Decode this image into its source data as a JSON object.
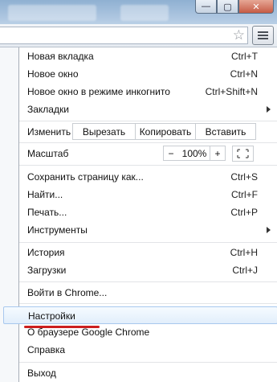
{
  "window": {
    "minimize": "—",
    "maximize": "▢",
    "close": "✕"
  },
  "toolbar": {
    "bookmark_icon": "star-icon",
    "menu_icon": "wrench-menu-icon"
  },
  "menu": {
    "new_tab": {
      "label": "Новая вкладка",
      "shortcut": "Ctrl+T"
    },
    "new_window": {
      "label": "Новое окно",
      "shortcut": "Ctrl+N"
    },
    "incognito": {
      "label": "Новое окно в режиме инкогнито",
      "shortcut": "Ctrl+Shift+N"
    },
    "bookmarks": {
      "label": "Закладки"
    },
    "edit": {
      "label": "Изменить",
      "cut": "Вырезать",
      "copy": "Копировать",
      "paste": "Вставить"
    },
    "zoom": {
      "label": "Масштаб",
      "minus": "−",
      "value": "100%",
      "plus": "+"
    },
    "save_page": {
      "label": "Сохранить страницу как...",
      "shortcut": "Ctrl+S"
    },
    "find": {
      "label": "Найти...",
      "shortcut": "Ctrl+F"
    },
    "print": {
      "label": "Печать...",
      "shortcut": "Ctrl+P"
    },
    "tools": {
      "label": "Инструменты"
    },
    "history": {
      "label": "История",
      "shortcut": "Ctrl+H"
    },
    "downloads": {
      "label": "Загрузки",
      "shortcut": "Ctrl+J"
    },
    "signin": {
      "label": "Войти в Chrome..."
    },
    "settings": {
      "label": "Настройки"
    },
    "about": {
      "label": "О браузере Google Chrome"
    },
    "help": {
      "label": "Справка"
    },
    "exit": {
      "label": "Выход"
    }
  },
  "colors": {
    "highlight_border": "#a8c8ee",
    "annotation_underline": "#cc1f1f"
  }
}
